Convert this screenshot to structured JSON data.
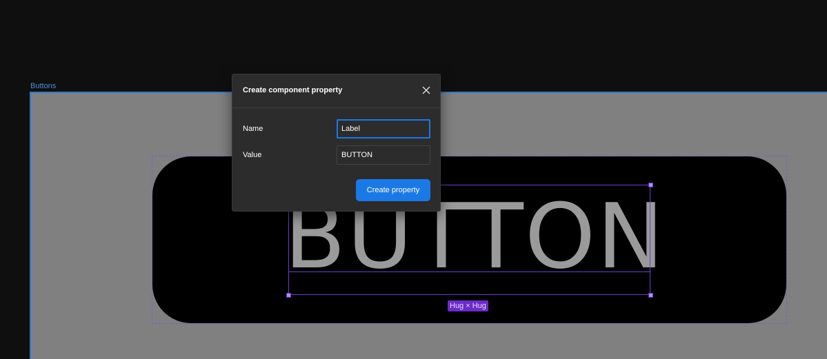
{
  "canvas": {
    "frame_label": "Buttons",
    "component_text": "BUTTON",
    "size_badge": "Hug × Hug"
  },
  "dialog": {
    "title": "Create component property",
    "close_icon": "close-icon",
    "fields": [
      {
        "label": "Name",
        "value": "Label"
      },
      {
        "label": "Value",
        "value": "BUTTON"
      }
    ],
    "submit_label": "Create property"
  },
  "colors": {
    "canvas_bg": "#0f0f0f",
    "frame_bg": "#808080",
    "frame_border": "#2f7ad1",
    "pill_bg": "#000000",
    "selection": "#6a3fd1",
    "badge_bg": "#6b2bc9",
    "dialog_bg": "#2c2c2c",
    "accent": "#1b79e6"
  }
}
